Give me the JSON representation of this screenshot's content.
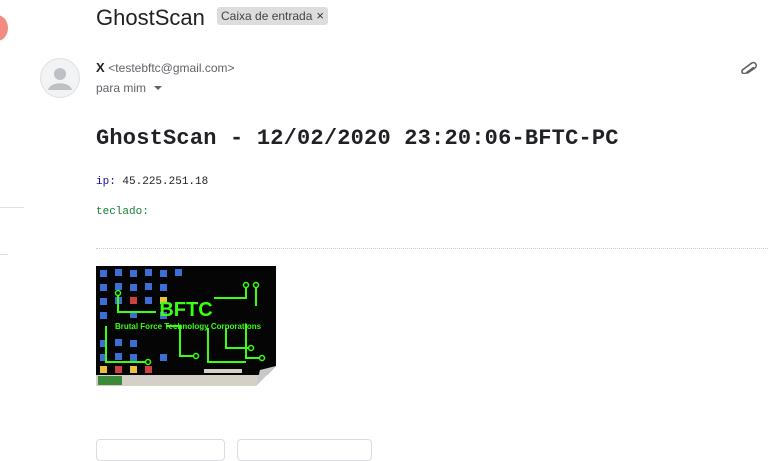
{
  "email": {
    "subject": "GhostScan",
    "label": "Caixa de entrada",
    "label_remove": "×",
    "sender_name": "X",
    "sender_email": "<testebftc@gmail.com>",
    "recipient": "para mim",
    "body_title": "GhostScan - 12/02/2020 23:20:06-BFTC-PC",
    "ip_label": "ip:",
    "ip_value": "45.225.251.18",
    "keys_label": "teclado:",
    "attachment": {
      "brand": "BFTC",
      "tagline": "Brutal Force Technology Corporations"
    }
  },
  "colors": {
    "ip_label": "#1a0dab",
    "keys_label": "#188038",
    "thumb_neon": "#39ff14"
  },
  "icons": [
    "avatar-icon",
    "paperclip-icon",
    "chevron-down-icon",
    "close-icon"
  ]
}
